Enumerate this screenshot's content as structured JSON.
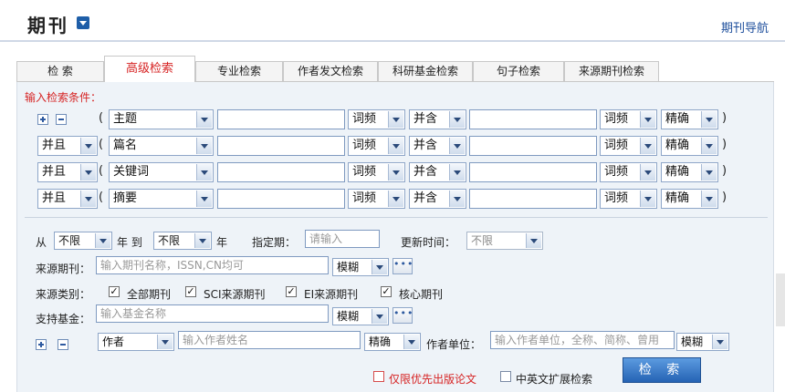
{
  "header": {
    "title": "期刊",
    "nav_link": "期刊导航"
  },
  "tabs": [
    "检 索",
    "高级检索",
    "专业检索",
    "作者发文检索",
    "科研基金检索",
    "句子检索",
    "来源期刊检索"
  ],
  "active_tab": "高级检索",
  "conditions_label": "输入检索条件：",
  "rows": [
    {
      "logic": "",
      "field": "主题",
      "freq1": "词频",
      "join": "并含",
      "freq2": "词频",
      "match": "精确"
    },
    {
      "logic": "并且",
      "field": "篇名",
      "freq1": "词频",
      "join": "并含",
      "freq2": "词频",
      "match": "精确"
    },
    {
      "logic": "并且",
      "field": "关键词",
      "freq1": "词频",
      "join": "并含",
      "freq2": "词频",
      "match": "精确"
    },
    {
      "logic": "并且",
      "field": "摘要",
      "freq1": "词频",
      "join": "并含",
      "freq2": "词频",
      "match": "精确"
    }
  ],
  "time": {
    "from_label": "从",
    "from_value": "不限",
    "year_to_label": "年 到",
    "to_value": "不限",
    "year_label": "年",
    "period_label": "指定期：",
    "period_placeholder": "请输入",
    "update_label": "更新时间：",
    "update_value": "不限"
  },
  "source": {
    "label": "来源期刊：",
    "placeholder": "输入期刊名称，ISSN,CN均可",
    "match": "模糊"
  },
  "source_type": {
    "label": "来源类别：",
    "options": [
      {
        "label": "全部期刊",
        "checked": true
      },
      {
        "label": "SCI来源期刊",
        "checked": true
      },
      {
        "label": "EI来源期刊",
        "checked": true
      },
      {
        "label": "核心期刊",
        "checked": true
      }
    ]
  },
  "fund": {
    "label": "支持基金：",
    "placeholder": "输入基金名称",
    "match": "模糊"
  },
  "author": {
    "field": "作者",
    "placeholder": "输入作者姓名",
    "match": "精确",
    "unit_label": "作者单位：",
    "unit_placeholder": "输入作者单位，全称、简称、曾用",
    "unit_match": "模糊"
  },
  "options": {
    "priority_label": "仅限优先出版论文",
    "bilingual_label": "中英文扩展检索"
  },
  "search_button": "检 索",
  "colors": {
    "accent_red": "#d62323",
    "link_blue": "#1e4f9c",
    "button_blue": "#2563b4",
    "panel_bg": "#eef3f8"
  }
}
